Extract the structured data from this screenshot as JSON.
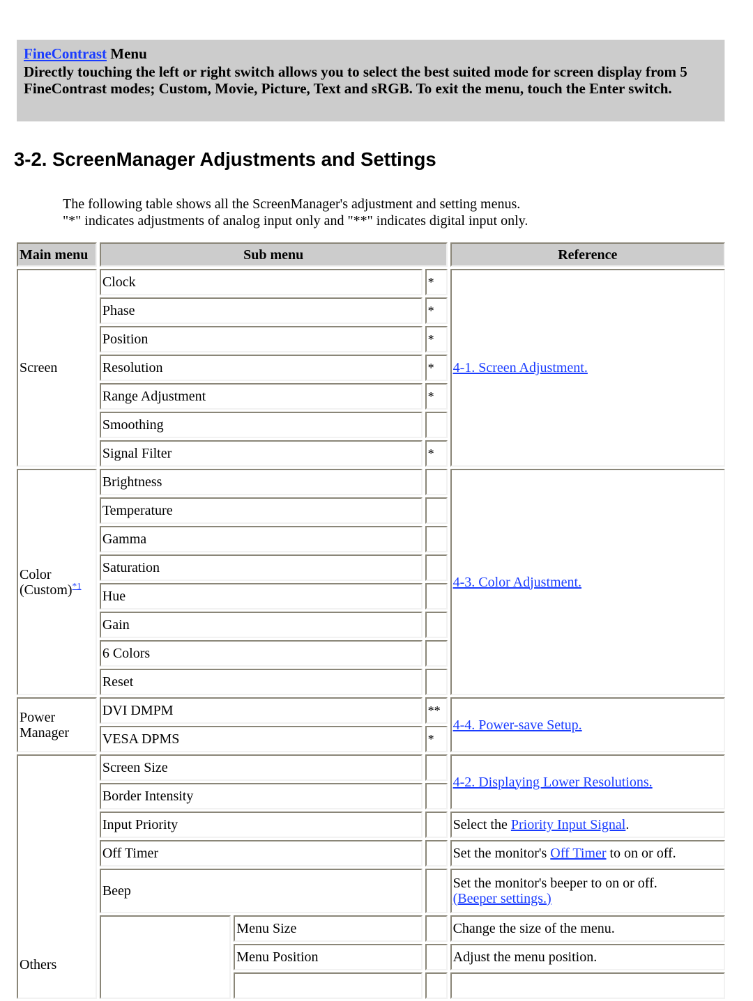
{
  "note": {
    "link_text": "FineContrast",
    "title_suffix": " Menu",
    "body": "Directly touching the left or right switch allows you to select the best suited mode for screen display from 5 FineContrast modes; Custom, Movie, Picture, Text and sRGB. To exit the menu, touch the Enter switch."
  },
  "section": {
    "title": "3-2. ScreenManager Adjustments and Settings",
    "intro_line1": "The following table shows all the ScreenManager's adjustment and setting menus.",
    "intro_line2": "\"*\" indicates adjustments of analog input only and \"**\" indicates digital input only."
  },
  "table": {
    "headers": {
      "main": "Main menu",
      "sub": "Sub menu",
      "ref": "Reference"
    },
    "screen": {
      "main": "Screen",
      "ref_link": "4-1. Screen Adjustment.",
      "items": [
        {
          "label": "Clock",
          "flag": "*"
        },
        {
          "label": "Phase",
          "flag": "*"
        },
        {
          "label": "Position",
          "flag": "*"
        },
        {
          "label": "Resolution",
          "flag": "*"
        },
        {
          "label": "Range Adjustment",
          "flag": "*"
        },
        {
          "label": "Smoothing",
          "flag": ""
        },
        {
          "label": "Signal Filter",
          "flag": "*"
        }
      ]
    },
    "color": {
      "main_line1": "Color",
      "main_line2": "(Custom)",
      "footnote_link": "*1",
      "ref_link": "4-3. Color Adjustment.",
      "items": [
        {
          "label": "Brightness",
          "flag": ""
        },
        {
          "label": "Temperature",
          "flag": ""
        },
        {
          "label": "Gamma",
          "flag": ""
        },
        {
          "label": "Saturation",
          "flag": ""
        },
        {
          "label": "Hue",
          "flag": ""
        },
        {
          "label": "Gain",
          "flag": ""
        },
        {
          "label": "6 Colors",
          "flag": ""
        },
        {
          "label": "Reset",
          "flag": ""
        }
      ]
    },
    "power": {
      "main_line1": "Power",
      "main_line2": "Manager",
      "ref_link": "4-4. Power-save Setup.",
      "items": [
        {
          "label": "DVI DMPM",
          "flag": "**"
        },
        {
          "label": "VESA DPMS",
          "flag": "*"
        }
      ]
    },
    "others": {
      "main": "Others",
      "lower_res_link": "4-2. Displaying Lower Resolutions.",
      "items": [
        {
          "label": "Screen Size",
          "flag": ""
        },
        {
          "label": "Border Intensity",
          "flag": ""
        },
        {
          "label": "Input Priority",
          "flag": "",
          "ref_prefix": "Select the ",
          "ref_link": "Priority Input Signal",
          "ref_suffix": "."
        },
        {
          "label": "Off Timer",
          "flag": "",
          "ref_prefix": "Set the monitor's ",
          "ref_link": "Off Timer",
          "ref_suffix": " to on or off."
        },
        {
          "label": "Beep",
          "flag": "",
          "ref_text": "Set the monitor's beeper to on or off.",
          "ref_link": "(Beeper settings.)"
        },
        {
          "label": "Menu Size",
          "flag": "",
          "ref_text": "Change the size of the menu."
        },
        {
          "label": "Menu Position",
          "flag": "",
          "ref_text": "Adjust the menu position."
        }
      ]
    }
  }
}
